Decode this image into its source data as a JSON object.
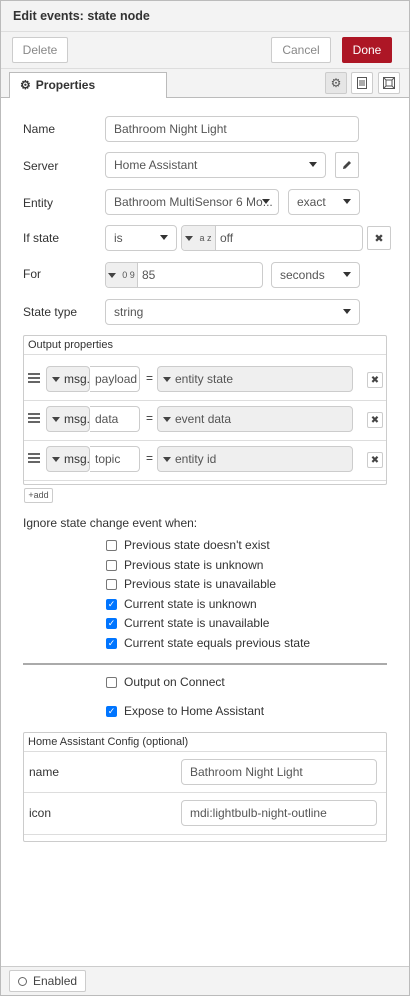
{
  "dialog": {
    "title": "Edit events: state node"
  },
  "toolbar": {
    "delete_label": "Delete",
    "cancel_label": "Cancel",
    "done_label": "Done"
  },
  "tabs": {
    "properties_label": "Properties",
    "icons": [
      "gear-icon",
      "description-icon",
      "appearance-icon"
    ]
  },
  "form": {
    "name": {
      "label": "Name",
      "value": "Bathroom Night Light"
    },
    "server": {
      "label": "Server",
      "value": "Home Assistant",
      "edit_icon": "pencil-icon"
    },
    "entity": {
      "label": "Entity",
      "value": "Bathroom MultiSensor 6 Mo...",
      "match": "exact"
    },
    "if_state": {
      "label": "If state",
      "operator": "is",
      "type_glyph": "a z",
      "value": "off"
    },
    "for": {
      "label": "For",
      "type_glyph": "0 9",
      "value": "85",
      "unit": "seconds"
    },
    "state_type": {
      "label": "State type",
      "value": "string"
    }
  },
  "output_properties": {
    "title": "Output properties",
    "rows": [
      {
        "prefix": "msg.",
        "property": "payload",
        "equals": "=",
        "value": "entity state"
      },
      {
        "prefix": "msg.",
        "property": "data",
        "equals": "=",
        "value": "event data"
      },
      {
        "prefix": "msg.",
        "property": "topic",
        "equals": "=",
        "value": "entity id"
      }
    ],
    "add_label": "add"
  },
  "ignore": {
    "heading": "Ignore state change event when:",
    "options": [
      {
        "label": "Previous state doesn't exist",
        "checked": false
      },
      {
        "label": "Previous state is unknown",
        "checked": false
      },
      {
        "label": "Previous state is unavailable",
        "checked": false
      },
      {
        "label": "Current state is unknown",
        "checked": true
      },
      {
        "label": "Current state is unavailable",
        "checked": true
      },
      {
        "label": "Current state equals previous state",
        "checked": true
      }
    ]
  },
  "output_on_connect": {
    "label": "Output on Connect",
    "checked": false
  },
  "expose": {
    "label": "Expose to Home Assistant",
    "checked": true
  },
  "ha_config": {
    "title": "Home Assistant Config (optional)",
    "rows": [
      {
        "key": "name",
        "value": "Bathroom Night Light"
      },
      {
        "key": "icon",
        "value": "mdi:lightbulb-night-outline"
      }
    ]
  },
  "footer": {
    "enabled_label": "Enabled"
  }
}
